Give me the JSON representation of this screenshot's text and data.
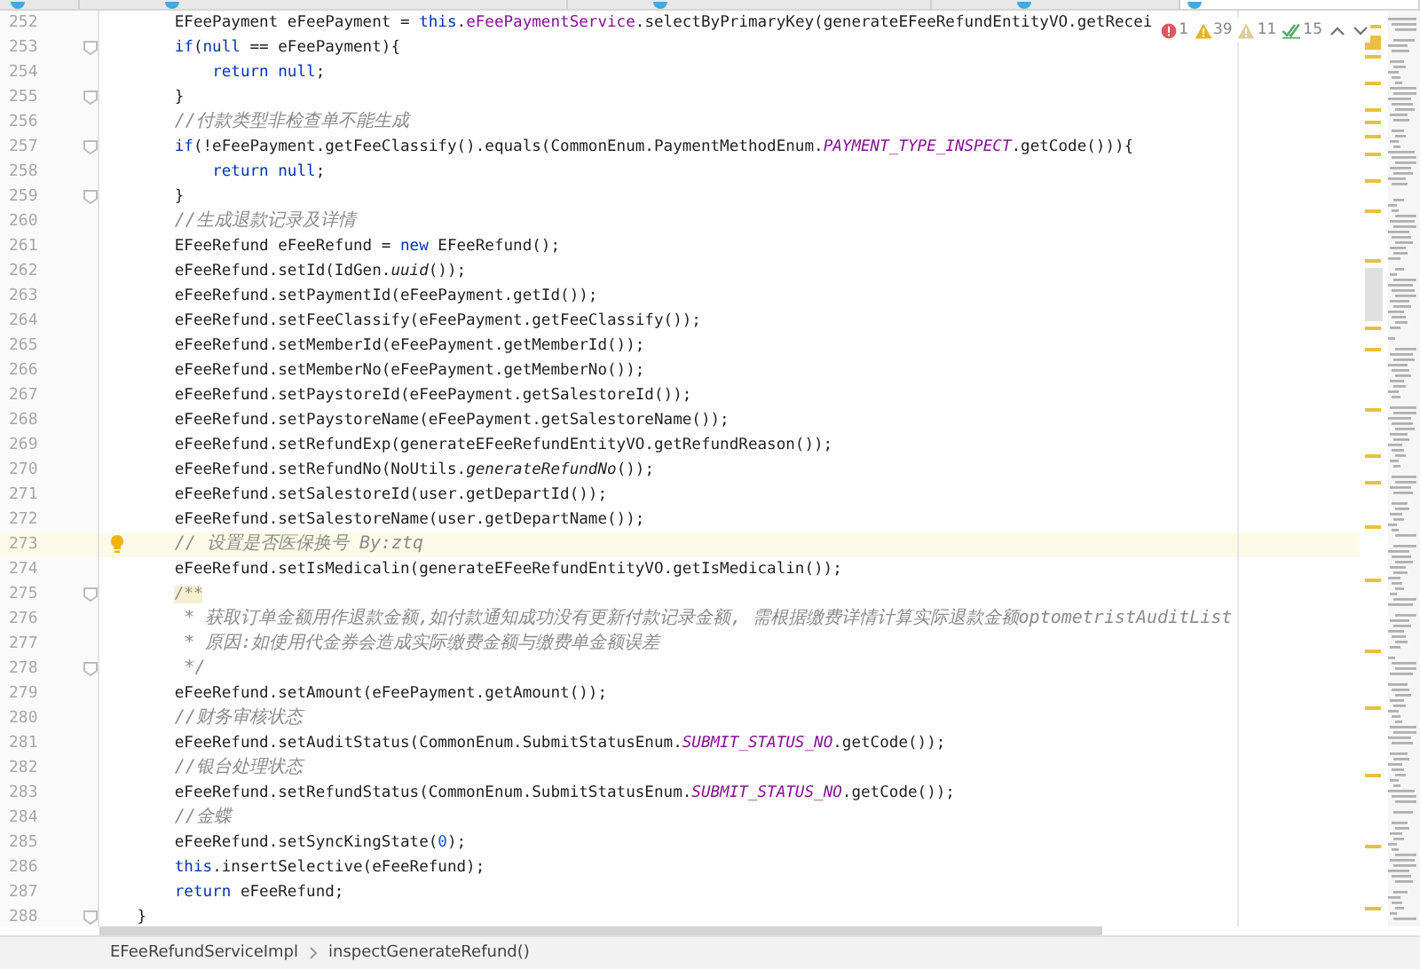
{
  "tabs": [
    {
      "selected": false
    },
    {
      "selected": false
    },
    {
      "selected": false
    },
    {
      "selected": false
    },
    {
      "selected": true
    }
  ],
  "inspections": [
    {
      "kind": "error",
      "count": "1"
    },
    {
      "kind": "warning",
      "count": "39"
    },
    {
      "kind": "weak",
      "count": "11"
    },
    {
      "kind": "typo",
      "count": "15"
    }
  ],
  "code": [
    {
      "number": "252",
      "segments": [
        {
          "kind": "plain",
          "text": "        EFeePayment eFeePayment = "
        },
        {
          "kind": "keyword",
          "text": "this"
        },
        {
          "kind": "plain",
          "text": "."
        },
        {
          "kind": "field",
          "text": "eFeePaymentService"
        },
        {
          "kind": "plain",
          "text": ".selectByPrimaryKey(generateEFeeRefundEntityVO.getRecei"
        }
      ]
    },
    {
      "number": "253",
      "fold": true,
      "segments": [
        {
          "kind": "keyword",
          "text": "        if"
        },
        {
          "kind": "plain",
          "text": "("
        },
        {
          "kind": "keyword",
          "text": "null"
        },
        {
          "kind": "plain",
          "text": " == eFeePayment){"
        }
      ]
    },
    {
      "number": "254",
      "segments": [
        {
          "kind": "keyword",
          "text": "            return null"
        },
        {
          "kind": "plain",
          "text": ";"
        }
      ]
    },
    {
      "number": "255",
      "fold": true,
      "segments": [
        {
          "kind": "plain",
          "text": "        }"
        }
      ]
    },
    {
      "number": "256",
      "segments": [
        {
          "kind": "comment",
          "text": "        //付款类型非检查单不能生成"
        }
      ]
    },
    {
      "number": "257",
      "fold": true,
      "segments": [
        {
          "kind": "keyword",
          "text": "        if"
        },
        {
          "kind": "plain",
          "text": "(!eFeePayment.getFeeClassify().equals(CommonEnum.PaymentMethodEnum."
        },
        {
          "kind": "constant",
          "text": "PAYMENT_TYPE_INSPECT"
        },
        {
          "kind": "plain",
          "text": ".getCode())){"
        }
      ]
    },
    {
      "number": "258",
      "segments": [
        {
          "kind": "keyword",
          "text": "            return null"
        },
        {
          "kind": "plain",
          "text": ";"
        }
      ]
    },
    {
      "number": "259",
      "fold": true,
      "segments": [
        {
          "kind": "plain",
          "text": "        }"
        }
      ]
    },
    {
      "number": "260",
      "segments": [
        {
          "kind": "comment",
          "text": "        //生成退款记录及详情"
        }
      ]
    },
    {
      "number": "261",
      "segments": [
        {
          "kind": "plain",
          "text": "        EFeeRefund eFeeRefund = "
        },
        {
          "kind": "keyword",
          "text": "new"
        },
        {
          "kind": "plain",
          "text": " EFeeRefund();"
        }
      ]
    },
    {
      "number": "262",
      "segments": [
        {
          "kind": "plain",
          "text": "        eFeeRefund.setId(IdGen."
        },
        {
          "kind": "static",
          "text": "uuid"
        },
        {
          "kind": "plain",
          "text": "());"
        }
      ]
    },
    {
      "number": "263",
      "segments": [
        {
          "kind": "plain",
          "text": "        eFeeRefund.setPaymentId(eFeePayment.getId());"
        }
      ]
    },
    {
      "number": "264",
      "segments": [
        {
          "kind": "plain",
          "text": "        eFeeRefund.setFeeClassify(eFeePayment.getFeeClassify());"
        }
      ]
    },
    {
      "number": "265",
      "segments": [
        {
          "kind": "plain",
          "text": "        eFeeRefund.setMemberId(eFeePayment.getMemberId());"
        }
      ]
    },
    {
      "number": "266",
      "segments": [
        {
          "kind": "plain",
          "text": "        eFeeRefund.setMemberNo(eFeePayment.getMemberNo());"
        }
      ]
    },
    {
      "number": "267",
      "segments": [
        {
          "kind": "plain",
          "text": "        eFeeRefund.setPaystoreId(eFeePayment.getSalestoreId());"
        }
      ]
    },
    {
      "number": "268",
      "segments": [
        {
          "kind": "plain",
          "text": "        eFeeRefund.setPaystoreName(eFeePayment.getSalestoreName());"
        }
      ]
    },
    {
      "number": "269",
      "segments": [
        {
          "kind": "plain",
          "text": "        eFeeRefund.setRefundExp(generateEFeeRefundEntityVO.getRefundReason());"
        }
      ]
    },
    {
      "number": "270",
      "segments": [
        {
          "kind": "plain",
          "text": "        eFeeRefund.setRefundNo(NoUtils."
        },
        {
          "kind": "static",
          "text": "generateRefundNo"
        },
        {
          "kind": "plain",
          "text": "());"
        }
      ]
    },
    {
      "number": "271",
      "segments": [
        {
          "kind": "plain",
          "text": "        eFeeRefund.setSalestoreId(user.getDepartId());"
        }
      ]
    },
    {
      "number": "272",
      "segments": [
        {
          "kind": "plain",
          "text": "        eFeeRefund.setSalestoreName(user.getDepartName());"
        }
      ]
    },
    {
      "number": "273",
      "current": true,
      "bulb": true,
      "segments": [
        {
          "kind": "comment",
          "text": "        // 设置是否医保换号 By:ztq"
        }
      ]
    },
    {
      "number": "274",
      "segments": [
        {
          "kind": "plain",
          "text": "        eFeeRefund.setIsMedicalin(generateEFeeRefundEntityVO.getIsMedicalin());"
        }
      ]
    },
    {
      "number": "275",
      "fold": true,
      "segments": [
        {
          "kind": "doc",
          "text": "        /**"
        }
      ]
    },
    {
      "number": "276",
      "segments": [
        {
          "kind": "comment",
          "text": "         * 获取订单金额用作退款金额,如付款通知成功没有更新付款记录金额, 需根据缴费详情计算实际退款金额optometristAuditList"
        }
      ]
    },
    {
      "number": "277",
      "segments": [
        {
          "kind": "comment",
          "text": "         * 原因:如使用代金券会造成实际缴费金额与缴费单金额误差"
        }
      ]
    },
    {
      "number": "278",
      "fold": true,
      "segments": [
        {
          "kind": "comment",
          "text": "         */"
        }
      ]
    },
    {
      "number": "279",
      "segments": [
        {
          "kind": "plain",
          "text": "        eFeeRefund.setAmount(eFeePayment.getAmount());"
        }
      ]
    },
    {
      "number": "280",
      "segments": [
        {
          "kind": "comment",
          "text": "        //财务审核状态"
        }
      ]
    },
    {
      "number": "281",
      "segments": [
        {
          "kind": "plain",
          "text": "        eFeeRefund.setAuditStatus(CommonEnum.SubmitStatusEnum."
        },
        {
          "kind": "constant",
          "text": "SUBMIT_STATUS_NO"
        },
        {
          "kind": "plain",
          "text": ".getCode());"
        }
      ]
    },
    {
      "number": "282",
      "segments": [
        {
          "kind": "comment",
          "text": "        //银台处理状态"
        }
      ]
    },
    {
      "number": "283",
      "segments": [
        {
          "kind": "plain",
          "text": "        eFeeRefund.setRefundStatus(CommonEnum.SubmitStatusEnum."
        },
        {
          "kind": "constant",
          "text": "SUBMIT_STATUS_NO"
        },
        {
          "kind": "plain",
          "text": ".getCode());"
        }
      ]
    },
    {
      "number": "284",
      "segments": [
        {
          "kind": "comment",
          "text": "        //金蝶"
        }
      ]
    },
    {
      "number": "285",
      "segments": [
        {
          "kind": "plain",
          "text": "        eFeeRefund.setSyncKingState("
        },
        {
          "kind": "number",
          "text": "0"
        },
        {
          "kind": "plain",
          "text": ");"
        }
      ]
    },
    {
      "number": "286",
      "segments": [
        {
          "kind": "keyword",
          "text": "        this"
        },
        {
          "kind": "plain",
          "text": ".insertSelective(eFeeRefund);"
        }
      ]
    },
    {
      "number": "287",
      "segments": [
        {
          "kind": "keyword",
          "text": "        return"
        },
        {
          "kind": "plain",
          "text": " eFeeRefund;"
        }
      ]
    },
    {
      "number": "288",
      "fold": true,
      "segments": [
        {
          "kind": "plain",
          "text": "    }"
        }
      ]
    }
  ],
  "breadcrumbs": [
    "EFeeRefundServiceImpl",
    "inspectGenerateRefund()"
  ]
}
